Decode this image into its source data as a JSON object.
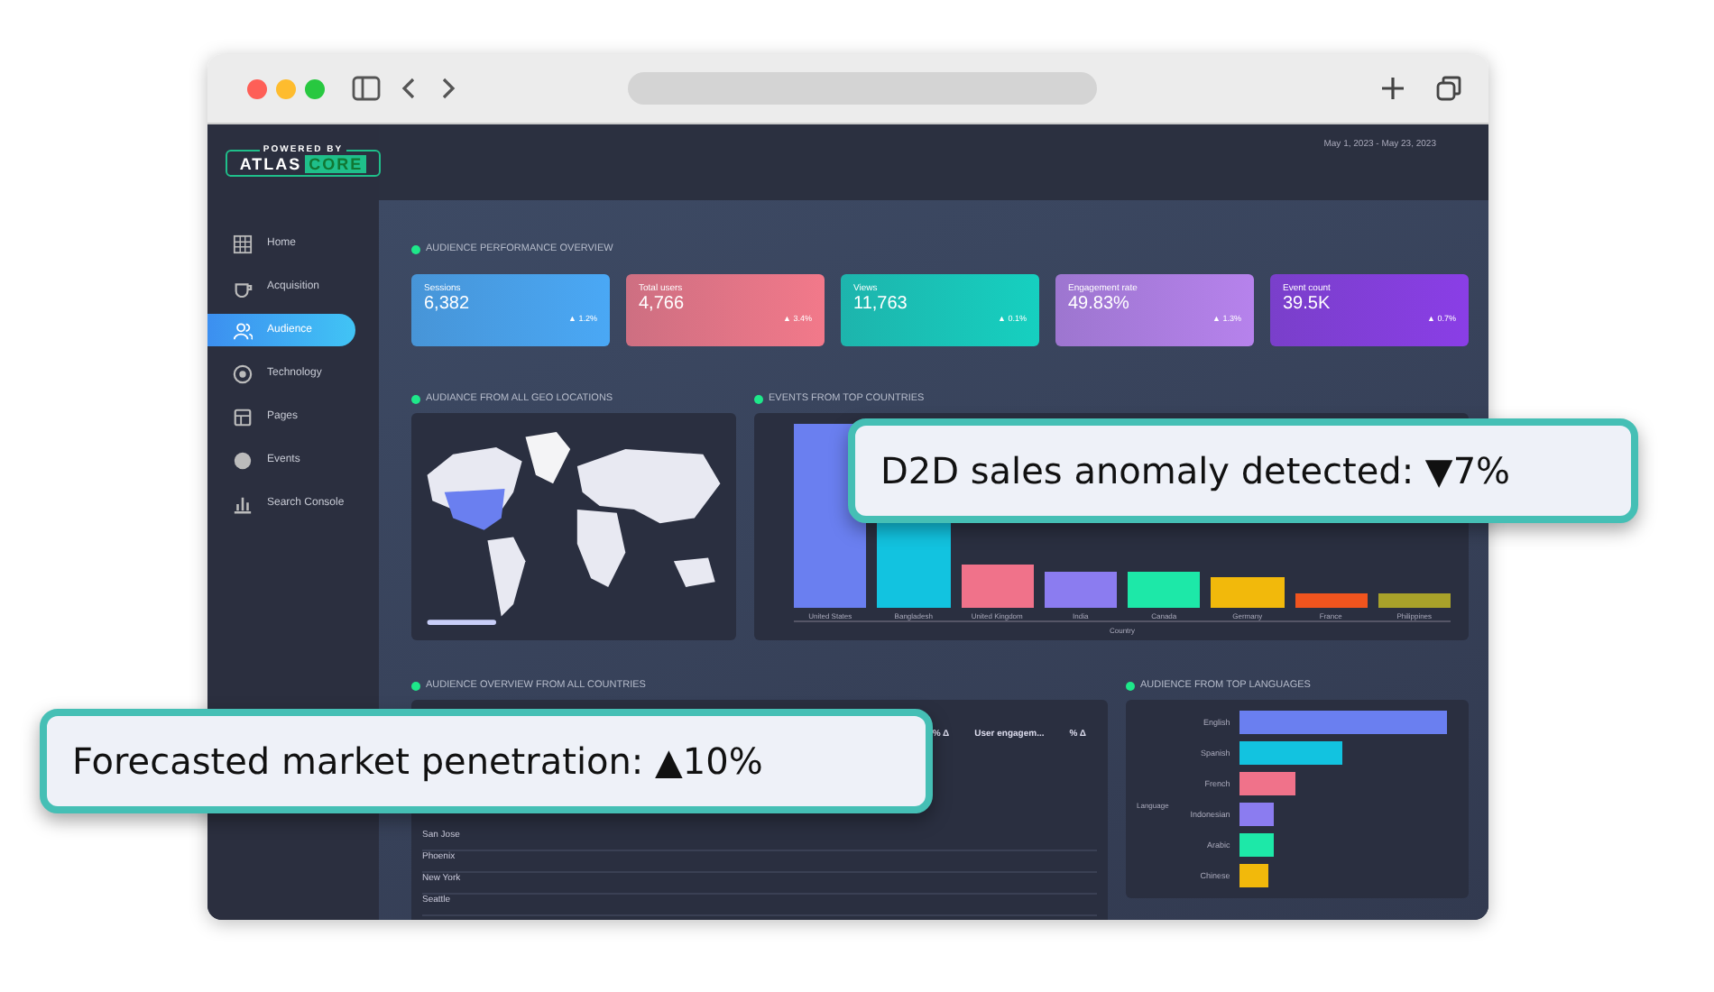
{
  "app": {
    "logo": {
      "tagline": "POWERED BY",
      "name": "ATLAS",
      "suffix": "CORE"
    },
    "date_range": "May 1, 2023 - May 23, 2023",
    "sidebar": {
      "items": [
        {
          "label": "Home",
          "selected": false
        },
        {
          "label": "Acquisition",
          "selected": false
        },
        {
          "label": "Audience",
          "selected": true
        },
        {
          "label": "Technology",
          "selected": false
        },
        {
          "label": "Pages",
          "selected": false
        },
        {
          "label": "Events",
          "selected": false
        },
        {
          "label": "Search Console",
          "selected": false
        }
      ]
    },
    "overview": {
      "title": "AUDIENCE PERFORMANCE OVERVIEW",
      "cards": [
        {
          "label": "Sessions",
          "value": "6,382",
          "delta": "▲ 1.2%",
          "color": "#4aa8f5"
        },
        {
          "label": "Total users",
          "value": "4,766",
          "delta": "▲ 3.4%",
          "color": "#f2798a"
        },
        {
          "label": "Views",
          "value": "11,763",
          "delta": "▲ 0.1%",
          "color": "#16d0c0"
        },
        {
          "label": "Engagement rate",
          "value": "49.83%",
          "delta": "▲ 1.3%",
          "color": "#b682ec"
        },
        {
          "label": "Event count",
          "value": "39.5K",
          "delta": "▲ 0.7%",
          "color": "#8a3ee6"
        }
      ]
    },
    "geo": {
      "title": "AUDIANCE FROM ALL GEO LOCATIONS"
    },
    "countries": {
      "title": "EVENTS FROM TOP COUNTRIES",
      "xlabel": "Country",
      "categories": [
        "United States",
        "Bangladesh",
        "United Kingdom",
        "India",
        "Canada",
        "Germany",
        "France",
        "Philippines"
      ]
    },
    "table": {
      "title": "AUDIENCE OVERVIEW FROM ALL COUNTRIES",
      "columns": [
        "% Δ",
        "User engagem...",
        "% Δ"
      ],
      "rows": [
        "San Jose",
        "Phoenix",
        "New York",
        "Seattle"
      ]
    },
    "languages": {
      "title": "AUDIENCE FROM TOP LANGUAGES",
      "ylabel": "Language",
      "items": [
        "English",
        "Spanish",
        "French",
        "Indonesian",
        "Arabic",
        "Chinese"
      ]
    }
  },
  "callouts": [
    {
      "text": "D2D sales anomaly detected: ▼7%"
    },
    {
      "text": "Forecasted market penetration: ▲10%"
    }
  ]
}
